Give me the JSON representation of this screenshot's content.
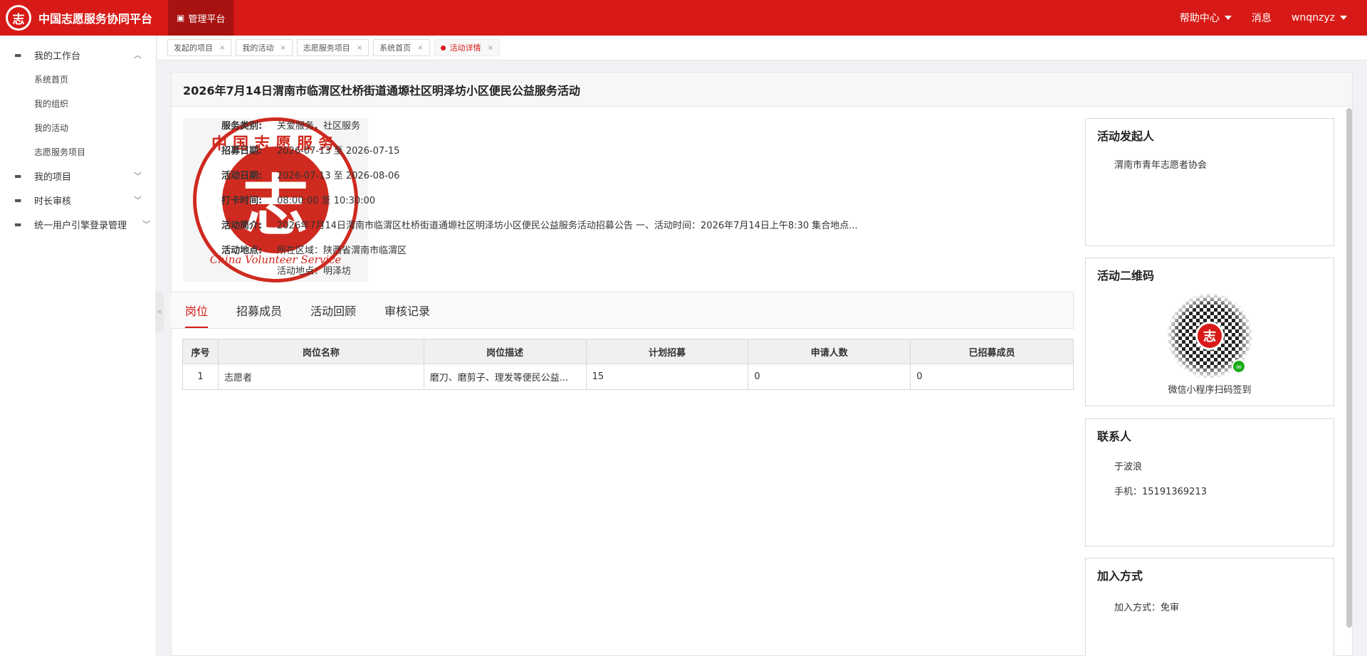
{
  "header": {
    "title": "中国志愿服务协同平台",
    "logo_char": "志",
    "platform_tab": "管理平台",
    "help": "帮助中心",
    "messages": "消息",
    "user": "wnqnzyz"
  },
  "sidebar": {
    "groups": [
      {
        "label": "我的工作台",
        "children": [
          "系统首页",
          "我的组织",
          "我的活动",
          "志愿服务项目"
        ]
      },
      {
        "label": "我的项目"
      },
      {
        "label": "时长审核"
      },
      {
        "label": "统一用户引擎登录管理"
      }
    ],
    "collapse_glyph": "«"
  },
  "page_tabs": [
    {
      "label": "发起的项目"
    },
    {
      "label": "我的活动"
    },
    {
      "label": "志愿服务项目"
    },
    {
      "label": "系统首页"
    },
    {
      "label": "活动详情",
      "active": true
    }
  ],
  "activity": {
    "title": "2026年7月14日渭南市临渭区杜桥街道通塬社区明泽坊小区便民公益服务活动",
    "poster": {
      "top_text": "中国志愿服务",
      "center_char": "志",
      "bottom_text": "China Volunteer Service"
    },
    "fields": {
      "service_type_label": "服务类别:",
      "service_type": "关爱服务，社区服务",
      "recruit_date_label": "招募日期:",
      "recruit_date": "2026-07-13 至 2026-07-15",
      "activity_date_label": "活动日期:",
      "activity_date": "2026-07-13 至 2026-08-06",
      "checkin_label": "打卡时间:",
      "checkin_time": "08:00:00 至 10:30:00",
      "intro_label": "活动简介:",
      "intro": "2026年7月14日渭南市临渭区杜桥街道通塬社区明泽坊小区便民公益服务活动招募公告 一、活动时间：2026年7月14日上午8:30 集合地点...",
      "location_label": "活动地点:",
      "region": "所在区域：陕西省渭南市临渭区",
      "place": "活动地点：明泽坊"
    }
  },
  "detail_tabs": [
    "岗位",
    "招募成员",
    "活动回顾",
    "审核记录"
  ],
  "jobs_table": {
    "headers": [
      "序号",
      "岗位名称",
      "岗位描述",
      "计划招募",
      "申请人数",
      "已招募成员"
    ],
    "rows": [
      [
        "1",
        "志愿者",
        "磨刀、磨剪子、理发等便民公益...",
        "15",
        "0",
        "0"
      ]
    ]
  },
  "panels": {
    "organizer": {
      "title": "活动发起人",
      "name": "渭南市青年志愿者协会"
    },
    "qrcode": {
      "title": "活动二维码",
      "center_char": "志",
      "caption": "微信小程序扫码签到"
    },
    "contact": {
      "title": "联系人",
      "name": "于波浪",
      "phone": "手机：15191369213"
    },
    "join": {
      "title": "加入方式",
      "method": "加入方式：免审"
    }
  }
}
